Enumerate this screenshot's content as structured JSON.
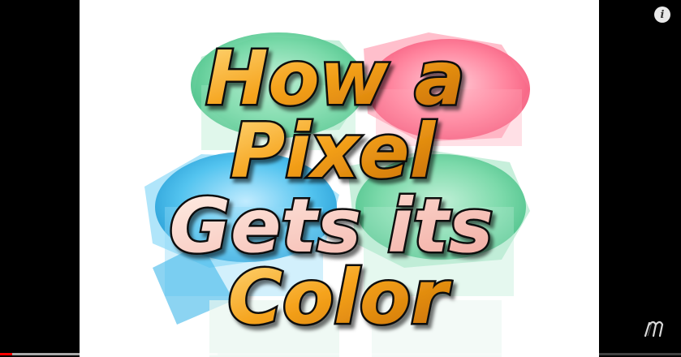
{
  "video": {
    "title_lines": [
      "How a",
      "Pixel",
      "Gets its",
      "Color"
    ]
  },
  "controls": {
    "info_icon": "info-icon",
    "info_glyph": "i",
    "watermark_icon": "channel-watermark-icon",
    "progress_played": 0.018,
    "progress_buffered": 0.32,
    "accent_color": "#ff0000"
  },
  "colors": {
    "jar_green": "#5fcf97",
    "jar_pink": "#ff6f8c",
    "jar_blue": "#35b6e8"
  }
}
